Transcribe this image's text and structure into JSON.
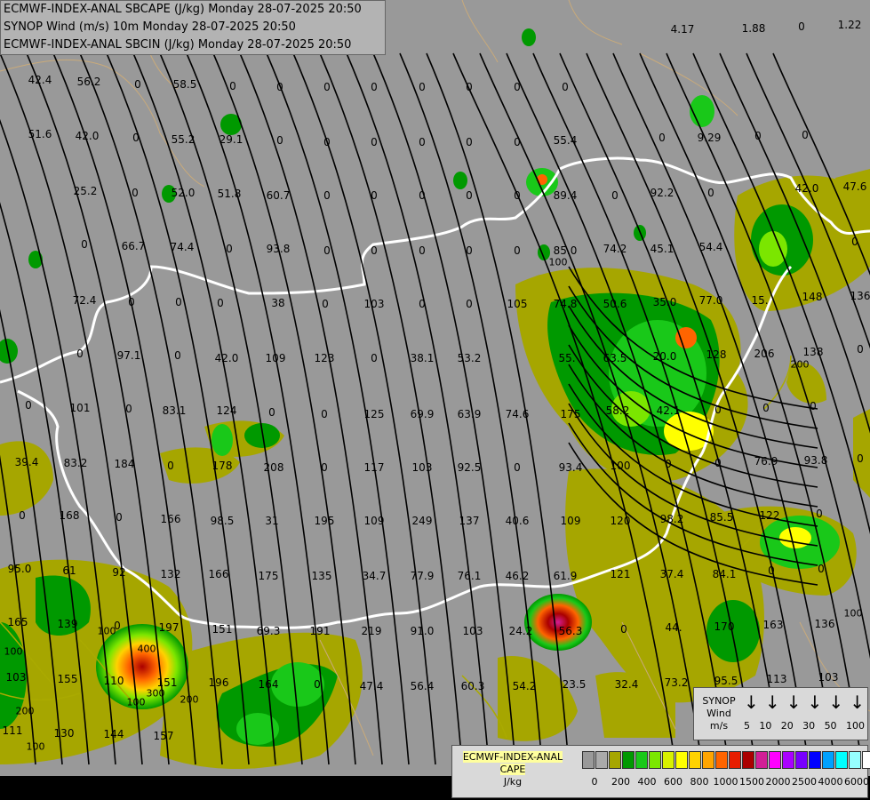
{
  "header": {
    "line1": "ECMWF-INDEX-ANAL SBCAPE (J/kg) Monday 28-07-2025 20:50",
    "line2": "SYNOP Wind (m/s) 10m Monday 28-07-2025 20:50",
    "line3": "ECMWF-INDEX-ANAL SBCIN (J/kg) Monday 28-07-2025 20:50"
  },
  "map_values": [
    "42.4",
    "56.2",
    "0",
    "58.5",
    "0",
    "0",
    "0",
    "0",
    "0",
    "0",
    "0",
    "0",
    "4.17",
    "1.88",
    "0",
    "1.22",
    "51.6",
    "42.0",
    "0",
    "55.2",
    "29.1",
    "0",
    "0",
    "0",
    "0",
    "0",
    "0",
    "55.4",
    "0",
    "9.29",
    "0",
    "0",
    "25.2",
    "0",
    "52.0",
    "51.8",
    "60.7",
    "0",
    "0",
    "0",
    "0",
    "0",
    "89.4",
    "0",
    "92.2",
    "0",
    "42.0",
    "47.6",
    "0",
    "66.7",
    "74.4",
    "0",
    "93.8",
    "0",
    "0",
    "0",
    "0",
    "0",
    "85.0",
    "74.2",
    "45.1",
    "54.4",
    "0",
    "72.4",
    "0",
    "0",
    "0",
    "38",
    "0",
    "103",
    "0",
    "0",
    "105",
    "74.8",
    "50.6",
    "35.0",
    "77.0",
    "15.",
    "148",
    "136",
    "0",
    "97.1",
    "0",
    "42.0",
    "109",
    "123",
    "0",
    "38.1",
    "53.2",
    "55.",
    "63.5",
    "20.0",
    "128",
    "206",
    "138",
    "0",
    "0",
    "101",
    "0",
    "83.1",
    "124",
    "0",
    "0",
    "125",
    "69.9",
    "63.9",
    "74.6",
    "175",
    "58.2",
    "42.1",
    "0",
    "0",
    "0",
    "39.4",
    "83.2",
    "184",
    "0",
    "178",
    "208",
    "0",
    "117",
    "103",
    "92.5",
    "0",
    "93.4",
    "100",
    "0",
    "0",
    "76.9",
    "93.8",
    "0",
    "0",
    "168",
    "0",
    "166",
    "98.5",
    "31",
    "195",
    "109",
    "249",
    "137",
    "40.6",
    "109",
    "120",
    "98.2",
    "85.5",
    "122",
    "0",
    "95.0",
    "61",
    "92",
    "132",
    "166",
    "175",
    "135",
    "34.7",
    "77.9",
    "76.1",
    "46.2",
    "61.9",
    "121",
    "37.4",
    "84.1",
    "0",
    "0",
    "165",
    "139",
    "0",
    "197",
    "151",
    "69.3",
    "191",
    "219",
    "91.0",
    "103",
    "24.2",
    "56.3",
    "0",
    "44.",
    "170",
    "163",
    "136",
    "103",
    "155",
    "110",
    "151",
    "196",
    "164",
    "0",
    "47.4",
    "56.4",
    "60.3",
    "54.2",
    "23.5",
    "32.4",
    "73.2",
    "95.5",
    "113",
    "103",
    "111",
    "130",
    "144",
    "157"
  ],
  "contour_labels": [
    "100",
    "200",
    "300",
    "400",
    "100",
    "100",
    "200",
    "100",
    "200",
    "100",
    "100"
  ],
  "wind_legend": {
    "line1": "SYNOP",
    "line2": "Wind",
    "line3": "m/s",
    "speeds": [
      "5",
      "10",
      "20",
      "30",
      "50",
      "100"
    ]
  },
  "cape_legend": {
    "line1": "ECMWF-INDEX-ANAL",
    "line2": "CAPE",
    "line3": "J/kg",
    "colors": [
      "#999999",
      "#aaaaaa",
      "#a6a600",
      "#009900",
      "#19c819",
      "#7be600",
      "#d7f000",
      "#ffff00",
      "#ffd200",
      "#ffa500",
      "#ff6400",
      "#e61e00",
      "#aa0000",
      "#d21e96",
      "#ff00ff",
      "#aa00ff",
      "#7800ff",
      "#0000ff",
      "#00a0ff",
      "#00ffff",
      "#96ffff",
      "#ffffff"
    ],
    "ticks": [
      "0",
      "200",
      "400",
      "600",
      "800",
      "1000",
      "1500",
      "2000",
      "2500",
      "4000",
      "6000"
    ]
  }
}
